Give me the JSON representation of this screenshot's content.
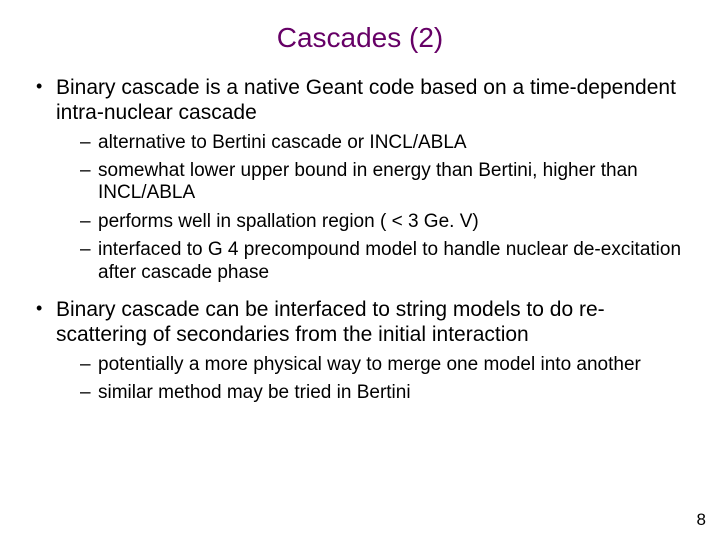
{
  "title": "Cascades (2)",
  "bullets": [
    {
      "text": "Binary cascade is a native Geant code based on a time-dependent intra-nuclear cascade",
      "sub": [
        "alternative to Bertini cascade or INCL/ABLA",
        "somewhat lower upper bound in energy than Bertini, higher than INCL/ABLA",
        "performs well in spallation region ( < 3 Ge. V)",
        "interfaced to G 4 precompound model to handle nuclear de-excitation after cascade phase"
      ]
    },
    {
      "text": "Binary cascade can be interfaced to string models to do re-scattering of secondaries from the initial interaction",
      "sub": [
        "potentially a more physical way to merge one model into another",
        "similar method may be tried in Bertini"
      ]
    }
  ],
  "page_number": "8"
}
